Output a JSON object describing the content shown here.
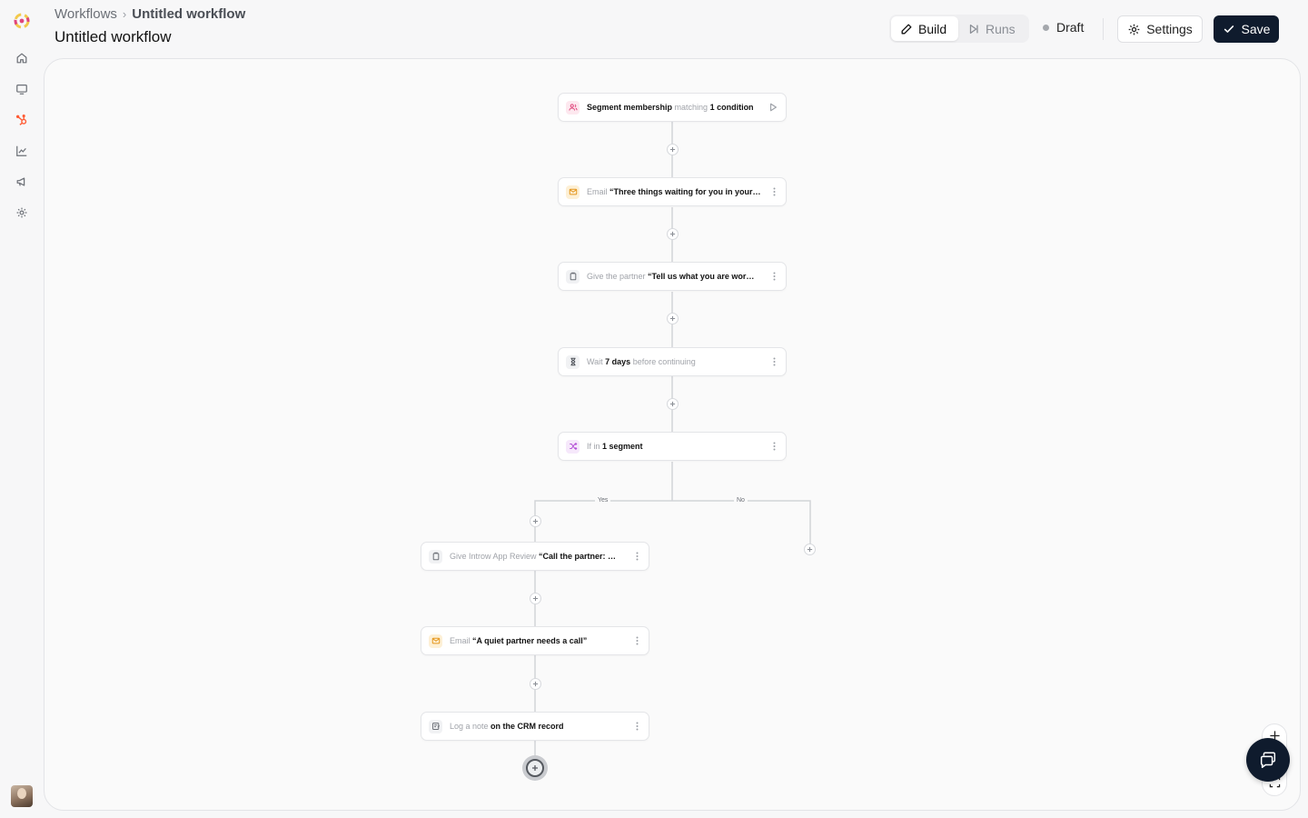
{
  "breadcrumb": {
    "root": "Workflows",
    "separator": "›",
    "current": "Untitled workflow"
  },
  "page_title": "Untitled workflow",
  "header": {
    "tabs": [
      {
        "label": "Build",
        "icon": "pencil-icon",
        "active": true
      },
      {
        "label": "Runs",
        "icon": "step-forward-icon",
        "active": false
      }
    ],
    "status": "Draft",
    "settings_label": "Settings",
    "save_label": "Save"
  },
  "sidebar": {
    "items": [
      {
        "name": "home",
        "icon": "home-icon"
      },
      {
        "name": "monitor",
        "icon": "monitor-icon"
      },
      {
        "name": "hubspot",
        "icon": "hubspot-icon",
        "color": "#ff5c35"
      },
      {
        "name": "analytics",
        "icon": "chart-line-icon"
      },
      {
        "name": "campaigns",
        "icon": "megaphone-icon"
      },
      {
        "name": "settings",
        "icon": "gear-icon"
      }
    ]
  },
  "workflow": {
    "trigger": {
      "pre": "Segment membership",
      "mid": " matching ",
      "post": "1 condition",
      "icon": "users-icon"
    },
    "steps": [
      {
        "type": "email",
        "muted": "Email ",
        "strong": "“Three things waiting for you in your…",
        "icon": "mail-icon"
      },
      {
        "type": "task",
        "muted": "Give the partner ",
        "strong": "“Tell us what you are wor…",
        "icon": "clipboard-icon"
      },
      {
        "type": "wait",
        "muted": "Wait ",
        "strong": "7 days",
        "muted_after": " before continuing",
        "icon": "hourglass-icon"
      },
      {
        "type": "branch",
        "muted": "If in ",
        "strong": "1 segment",
        "icon": "shuffle-icon"
      }
    ],
    "branch_labels": {
      "yes": "Yes",
      "no": "No"
    },
    "yes_steps": [
      {
        "type": "task",
        "muted": "Give Introw App Review ",
        "strong": "“Call the partner: …",
        "icon": "clipboard-icon"
      },
      {
        "type": "email",
        "muted": "Email ",
        "strong": "“A quiet partner needs a call”",
        "icon": "mail-icon"
      },
      {
        "type": "note",
        "muted": "Log a note ",
        "strong": "on the CRM record",
        "icon": "note-icon"
      }
    ]
  },
  "colors": {
    "accent_dark": "#0f1b2d",
    "email": "#f5a524",
    "trigger": "#e0457b",
    "branch": "#b34fd6",
    "hubspot": "#ff5c35"
  }
}
